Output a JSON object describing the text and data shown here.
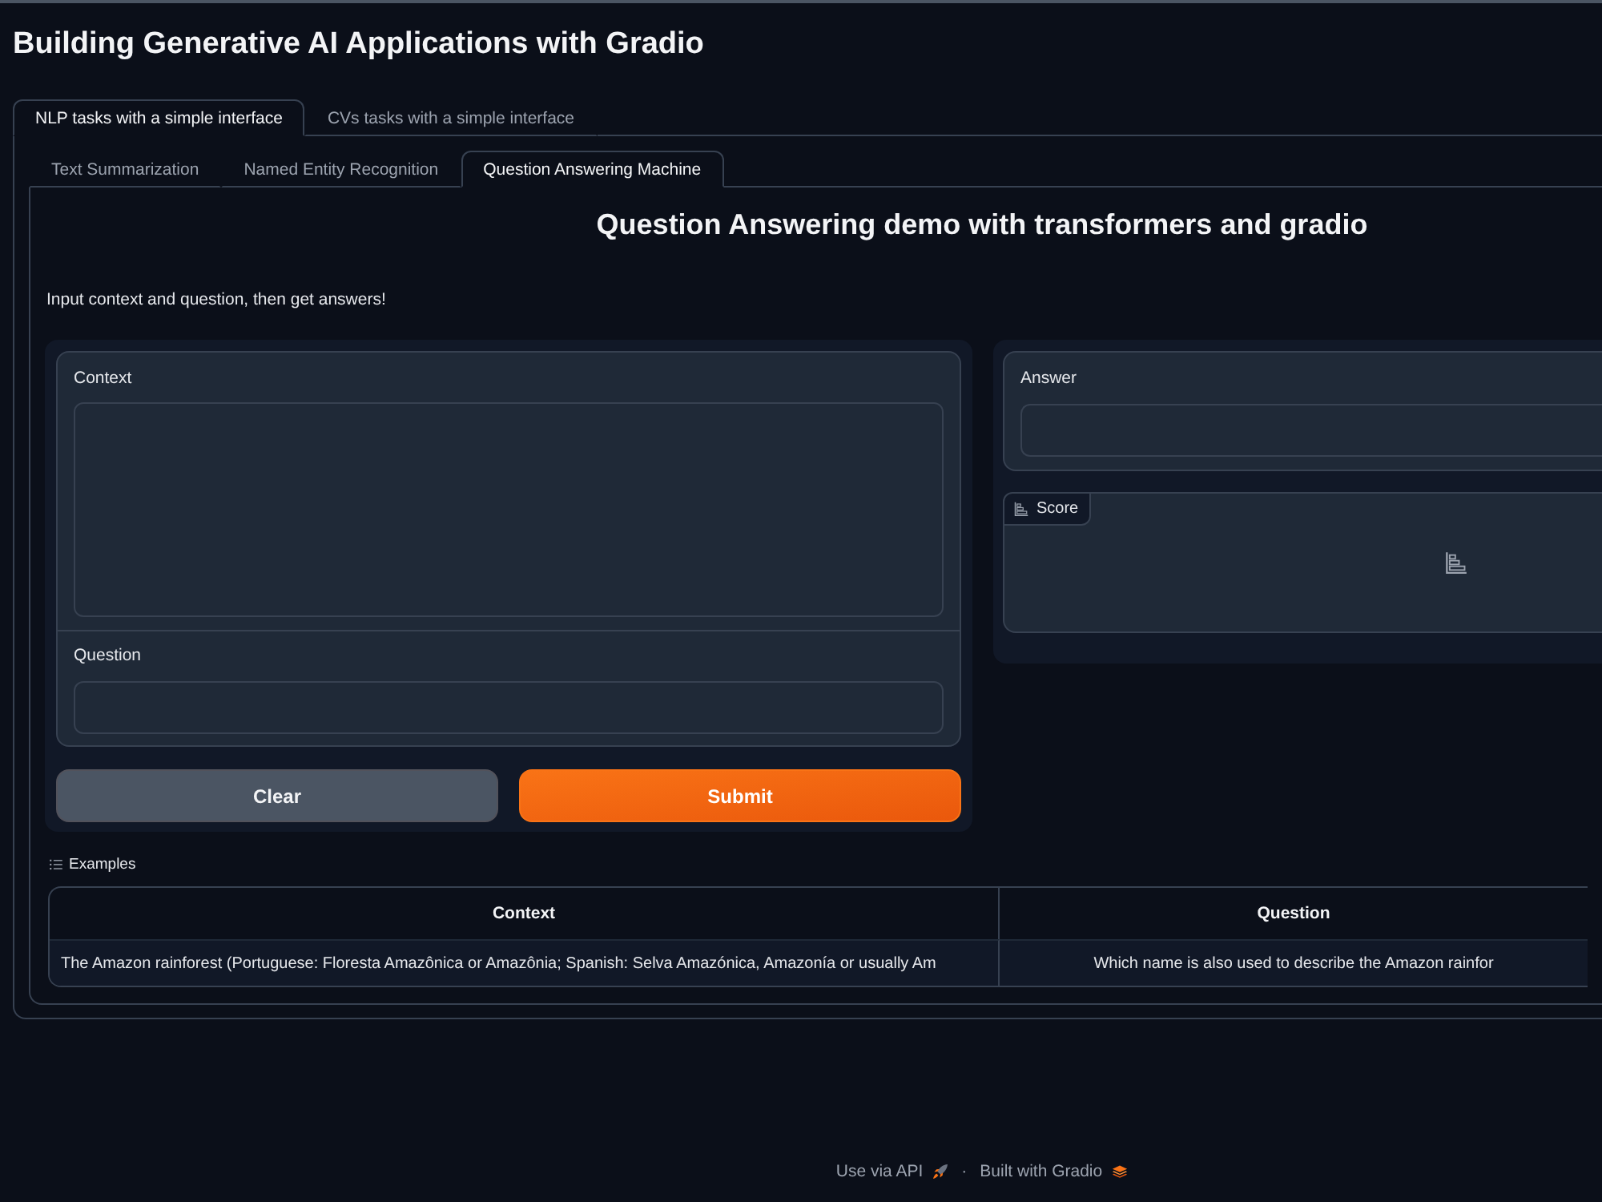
{
  "page": {
    "title": "Building Generative AI Applications with Gradio"
  },
  "tabs": [
    {
      "label": "NLP tasks with a simple interface",
      "selected": true
    },
    {
      "label": "CVs tasks with a simple interface",
      "selected": false
    }
  ],
  "subtabs": [
    {
      "label": "Text Summarization",
      "selected": false
    },
    {
      "label": "Named Entity Recognition",
      "selected": false
    },
    {
      "label": "Question Answering Machine",
      "selected": true
    }
  ],
  "demo": {
    "heading": "Question Answering demo with transformers and gradio",
    "description": "Input context and question, then get answers!"
  },
  "inputs": [
    {
      "label": "Context",
      "kind": "textarea"
    },
    {
      "label": "Question",
      "kind": "textbox"
    }
  ],
  "buttons": [
    {
      "label": "Clear",
      "kind": "secondary"
    },
    {
      "label": "Submit",
      "kind": "primary"
    }
  ],
  "outputs": [
    {
      "label": "Answer",
      "kind": "textbox"
    },
    {
      "label": "Score",
      "kind": "label"
    }
  ],
  "examples": {
    "label": "Examples",
    "columns": [
      "Context",
      "Question"
    ],
    "rows": [
      [
        "The Amazon rainforest (Portuguese: Floresta Amazônica or Amazônia; Spanish: Selva Amazónica, Amazonía or usually Am",
        "Which name is also used to describe the Amazon rainfor"
      ]
    ]
  },
  "footer": {
    "links": [
      {
        "label": "Use via API",
        "kind": "api"
      },
      {
        "label": "Built with Gradio",
        "kind": "gradio"
      }
    ],
    "separator": "·"
  }
}
